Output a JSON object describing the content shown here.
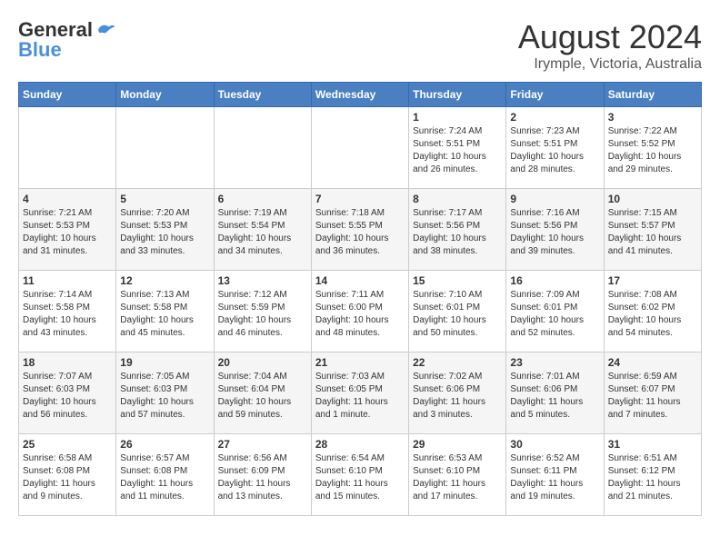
{
  "header": {
    "logo_general": "General",
    "logo_blue": "Blue",
    "month_title": "August 2024",
    "location": "Irymple, Victoria, Australia"
  },
  "weekdays": [
    "Sunday",
    "Monday",
    "Tuesday",
    "Wednesday",
    "Thursday",
    "Friday",
    "Saturday"
  ],
  "weeks": [
    [
      {
        "day": "",
        "info": ""
      },
      {
        "day": "",
        "info": ""
      },
      {
        "day": "",
        "info": ""
      },
      {
        "day": "",
        "info": ""
      },
      {
        "day": "1",
        "info": "Sunrise: 7:24 AM\nSunset: 5:51 PM\nDaylight: 10 hours\nand 26 minutes."
      },
      {
        "day": "2",
        "info": "Sunrise: 7:23 AM\nSunset: 5:51 PM\nDaylight: 10 hours\nand 28 minutes."
      },
      {
        "day": "3",
        "info": "Sunrise: 7:22 AM\nSunset: 5:52 PM\nDaylight: 10 hours\nand 29 minutes."
      }
    ],
    [
      {
        "day": "4",
        "info": "Sunrise: 7:21 AM\nSunset: 5:53 PM\nDaylight: 10 hours\nand 31 minutes."
      },
      {
        "day": "5",
        "info": "Sunrise: 7:20 AM\nSunset: 5:53 PM\nDaylight: 10 hours\nand 33 minutes."
      },
      {
        "day": "6",
        "info": "Sunrise: 7:19 AM\nSunset: 5:54 PM\nDaylight: 10 hours\nand 34 minutes."
      },
      {
        "day": "7",
        "info": "Sunrise: 7:18 AM\nSunset: 5:55 PM\nDaylight: 10 hours\nand 36 minutes."
      },
      {
        "day": "8",
        "info": "Sunrise: 7:17 AM\nSunset: 5:56 PM\nDaylight: 10 hours\nand 38 minutes."
      },
      {
        "day": "9",
        "info": "Sunrise: 7:16 AM\nSunset: 5:56 PM\nDaylight: 10 hours\nand 39 minutes."
      },
      {
        "day": "10",
        "info": "Sunrise: 7:15 AM\nSunset: 5:57 PM\nDaylight: 10 hours\nand 41 minutes."
      }
    ],
    [
      {
        "day": "11",
        "info": "Sunrise: 7:14 AM\nSunset: 5:58 PM\nDaylight: 10 hours\nand 43 minutes."
      },
      {
        "day": "12",
        "info": "Sunrise: 7:13 AM\nSunset: 5:58 PM\nDaylight: 10 hours\nand 45 minutes."
      },
      {
        "day": "13",
        "info": "Sunrise: 7:12 AM\nSunset: 5:59 PM\nDaylight: 10 hours\nand 46 minutes."
      },
      {
        "day": "14",
        "info": "Sunrise: 7:11 AM\nSunset: 6:00 PM\nDaylight: 10 hours\nand 48 minutes."
      },
      {
        "day": "15",
        "info": "Sunrise: 7:10 AM\nSunset: 6:01 PM\nDaylight: 10 hours\nand 50 minutes."
      },
      {
        "day": "16",
        "info": "Sunrise: 7:09 AM\nSunset: 6:01 PM\nDaylight: 10 hours\nand 52 minutes."
      },
      {
        "day": "17",
        "info": "Sunrise: 7:08 AM\nSunset: 6:02 PM\nDaylight: 10 hours\nand 54 minutes."
      }
    ],
    [
      {
        "day": "18",
        "info": "Sunrise: 7:07 AM\nSunset: 6:03 PM\nDaylight: 10 hours\nand 56 minutes."
      },
      {
        "day": "19",
        "info": "Sunrise: 7:05 AM\nSunset: 6:03 PM\nDaylight: 10 hours\nand 57 minutes."
      },
      {
        "day": "20",
        "info": "Sunrise: 7:04 AM\nSunset: 6:04 PM\nDaylight: 10 hours\nand 59 minutes."
      },
      {
        "day": "21",
        "info": "Sunrise: 7:03 AM\nSunset: 6:05 PM\nDaylight: 11 hours\nand 1 minute."
      },
      {
        "day": "22",
        "info": "Sunrise: 7:02 AM\nSunset: 6:06 PM\nDaylight: 11 hours\nand 3 minutes."
      },
      {
        "day": "23",
        "info": "Sunrise: 7:01 AM\nSunset: 6:06 PM\nDaylight: 11 hours\nand 5 minutes."
      },
      {
        "day": "24",
        "info": "Sunrise: 6:59 AM\nSunset: 6:07 PM\nDaylight: 11 hours\nand 7 minutes."
      }
    ],
    [
      {
        "day": "25",
        "info": "Sunrise: 6:58 AM\nSunset: 6:08 PM\nDaylight: 11 hours\nand 9 minutes."
      },
      {
        "day": "26",
        "info": "Sunrise: 6:57 AM\nSunset: 6:08 PM\nDaylight: 11 hours\nand 11 minutes."
      },
      {
        "day": "27",
        "info": "Sunrise: 6:56 AM\nSunset: 6:09 PM\nDaylight: 11 hours\nand 13 minutes."
      },
      {
        "day": "28",
        "info": "Sunrise: 6:54 AM\nSunset: 6:10 PM\nDaylight: 11 hours\nand 15 minutes."
      },
      {
        "day": "29",
        "info": "Sunrise: 6:53 AM\nSunset: 6:10 PM\nDaylight: 11 hours\nand 17 minutes."
      },
      {
        "day": "30",
        "info": "Sunrise: 6:52 AM\nSunset: 6:11 PM\nDaylight: 11 hours\nand 19 minutes."
      },
      {
        "day": "31",
        "info": "Sunrise: 6:51 AM\nSunset: 6:12 PM\nDaylight: 11 hours\nand 21 minutes."
      }
    ]
  ]
}
